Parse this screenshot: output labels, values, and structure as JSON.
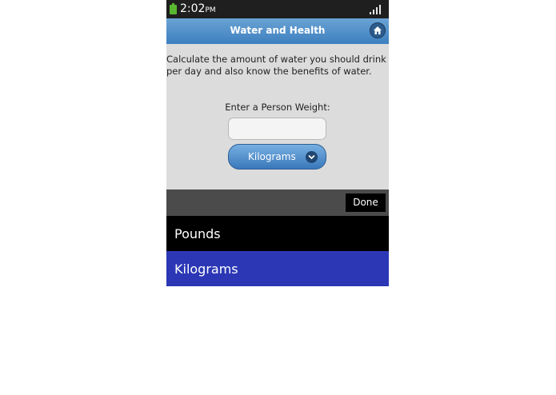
{
  "status_bar": {
    "time": "2:02",
    "ampm": "PM"
  },
  "header": {
    "title": "Water and Health"
  },
  "main": {
    "intro": "Calculate the amount of water you should drink per day and also know the benefits of water.",
    "weight_label": "Enter a Person Weight:",
    "weight_value": "",
    "unit_selected": "Kilograms"
  },
  "picker": {
    "done_label": "Done",
    "options": [
      "Pounds",
      "Kilograms"
    ],
    "selected_index": 1
  },
  "colors": {
    "header": "#4a8bc8",
    "selected_option": "#2b37b5",
    "battery": "#59b82f"
  }
}
